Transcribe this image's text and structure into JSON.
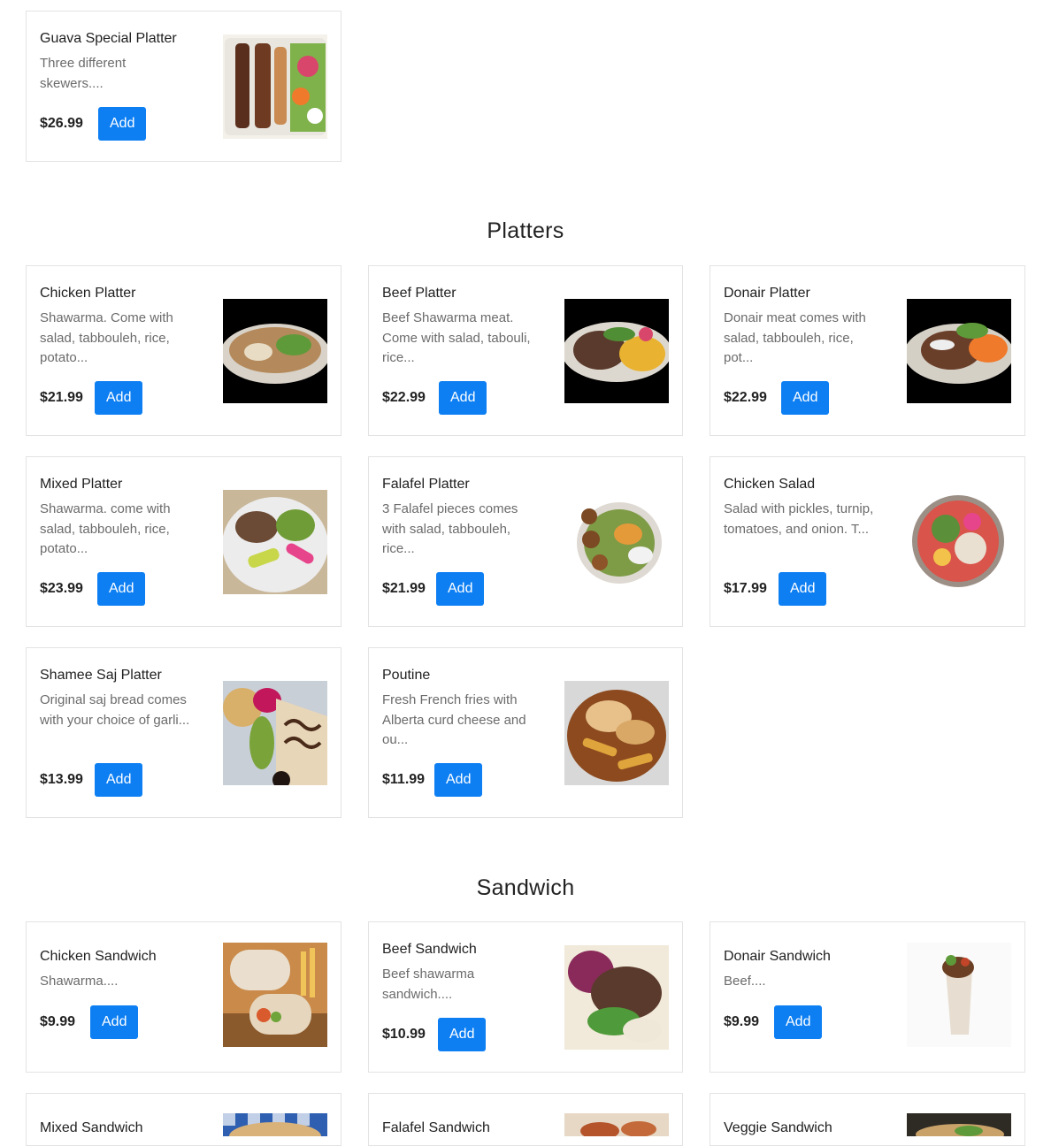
{
  "top_item": {
    "name": "Guava Special Platter",
    "desc": "Three different skewers....",
    "price": "$26.99",
    "add": "Add",
    "image": "kebab-skewers-platter-photo"
  },
  "platters": {
    "title": "Platters",
    "items": [
      {
        "name": "Chicken Platter",
        "desc": "Shawarma. Come with salad, tabbouleh, rice, potato...",
        "price": "$21.99",
        "add": "Add",
        "image": "chicken-platter-photo"
      },
      {
        "name": "Beef Platter",
        "desc": "Beef Shawarma meat. Come with salad, tabouli, rice...",
        "price": "$22.99",
        "add": "Add",
        "image": "beef-platter-photo"
      },
      {
        "name": "Donair Platter",
        "desc": "Donair meat comes with salad, tabbouleh, rice, pot...",
        "price": "$22.99",
        "add": "Add",
        "image": "donair-platter-photo"
      },
      {
        "name": "Mixed Platter",
        "desc": "Shawarma. come with salad, tabbouleh, rice, potato...",
        "price": "$23.99",
        "add": "Add",
        "image": "mixed-platter-photo"
      },
      {
        "name": "Falafel Platter",
        "desc": "3 Falafel pieces comes with salad, tabbouleh, rice...",
        "price": "$21.99",
        "add": "Add",
        "image": "falafel-platter-photo"
      },
      {
        "name": "Chicken Salad",
        "desc": "Salad with pickles, turnip, tomatoes, and onion. T...",
        "price": "$17.99",
        "add": "Add",
        "image": "chicken-salad-photo"
      },
      {
        "name": "Shamee Saj Platter",
        "desc": "Original saj bread comes with your choice of garli...",
        "price": "$13.99",
        "add": "Add",
        "image": "saj-platter-photo"
      },
      {
        "name": "Poutine",
        "desc": "Fresh French fries with Alberta curd cheese and ou...",
        "price": "$11.99",
        "add": "Add",
        "image": "poutine-photo"
      }
    ]
  },
  "sandwich": {
    "title": "Sandwich",
    "items": [
      {
        "name": "Chicken Sandwich",
        "desc": "Shawarma....",
        "price": "$9.99",
        "add": "Add",
        "image": "chicken-sandwich-photo"
      },
      {
        "name": "Beef Sandwich",
        "desc": "Beef shawarma sandwich....",
        "price": "$10.99",
        "add": "Add",
        "image": "beef-sandwich-photo"
      },
      {
        "name": "Donair Sandwich",
        "desc": "Beef....",
        "price": "$9.99",
        "add": "Add",
        "image": "donair-sandwich-photo"
      },
      {
        "name": "Mixed Sandwich",
        "image": "mixed-sandwich-photo"
      },
      {
        "name": "Falafel Sandwich",
        "image": "falafel-sandwich-photo"
      },
      {
        "name": "Veggie Sandwich",
        "image": "veggie-sandwich-photo"
      }
    ]
  },
  "colors": {
    "add_button": "#0d7ff3",
    "card_border": "#e3e3e3",
    "description": "#6b6b6b"
  }
}
